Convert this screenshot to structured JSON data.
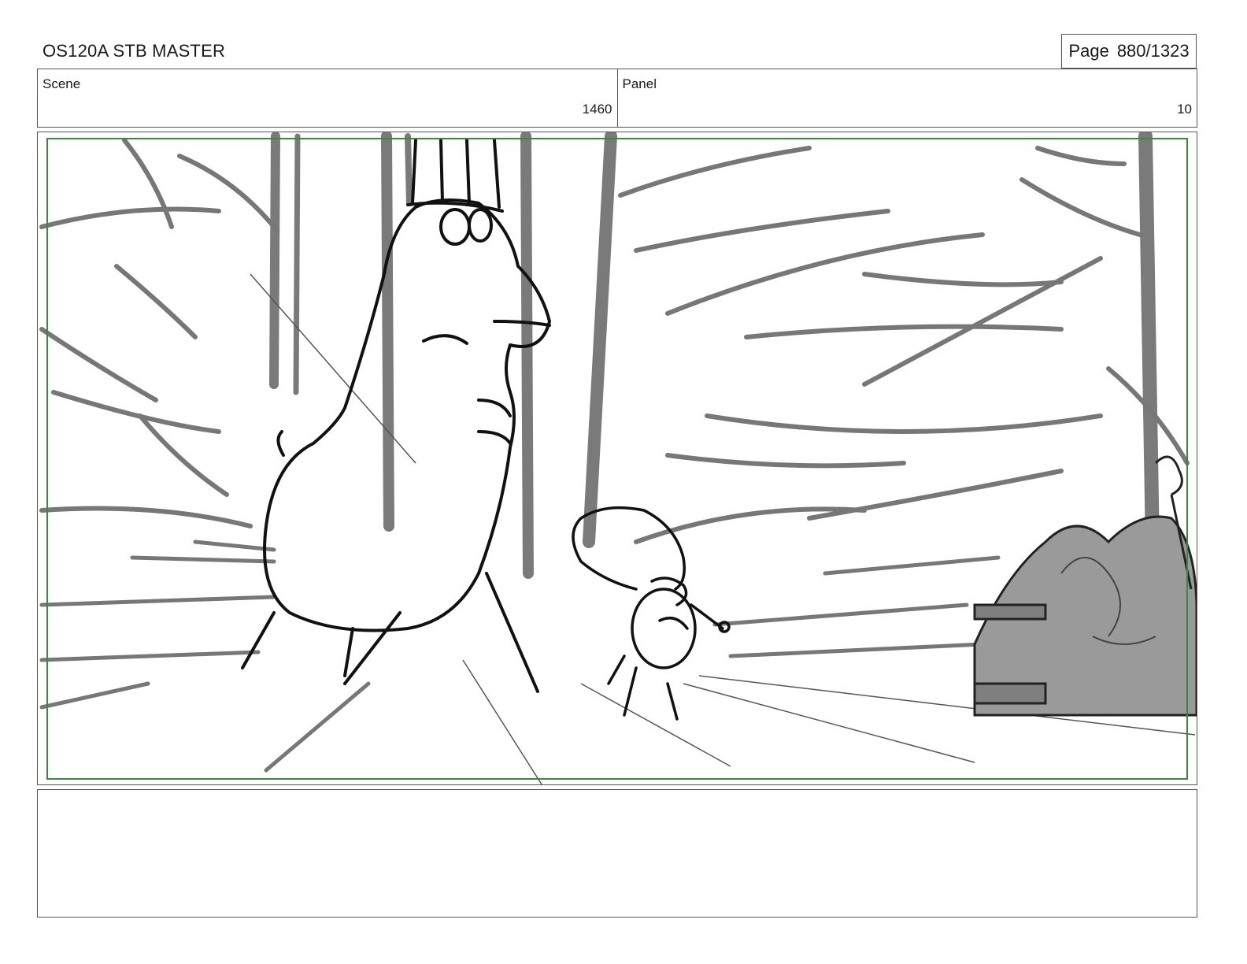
{
  "document": {
    "title": "OS120A STB MASTER",
    "page_label": "Page",
    "page_number": "880/1323"
  },
  "scene": {
    "label": "Scene",
    "value": "1460"
  },
  "panel": {
    "label": "Panel",
    "value": "10"
  },
  "drawing": {
    "safe_frame_color": "#3a8a3a",
    "line_color": "#111111",
    "tone_color": "#7a7a7a"
  },
  "notes": {
    "text": ""
  }
}
